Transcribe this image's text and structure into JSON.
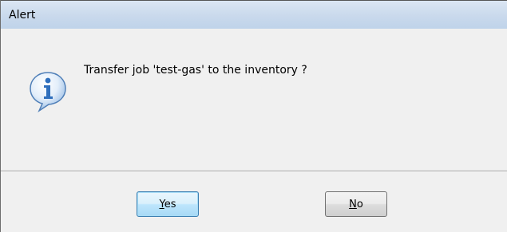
{
  "window": {
    "title": "Alert"
  },
  "dialog": {
    "icon": "info-icon",
    "message": "Transfer job 'test-gas' to the inventory ?"
  },
  "buttons": {
    "yes": {
      "mnemonic": "Y",
      "rest": "es"
    },
    "no": {
      "mnemonic": "N",
      "rest": "o"
    }
  },
  "colors": {
    "titlebar": "#c9d9ec",
    "background": "#f0f0f0",
    "icon_blue": "#2f6fbd"
  }
}
